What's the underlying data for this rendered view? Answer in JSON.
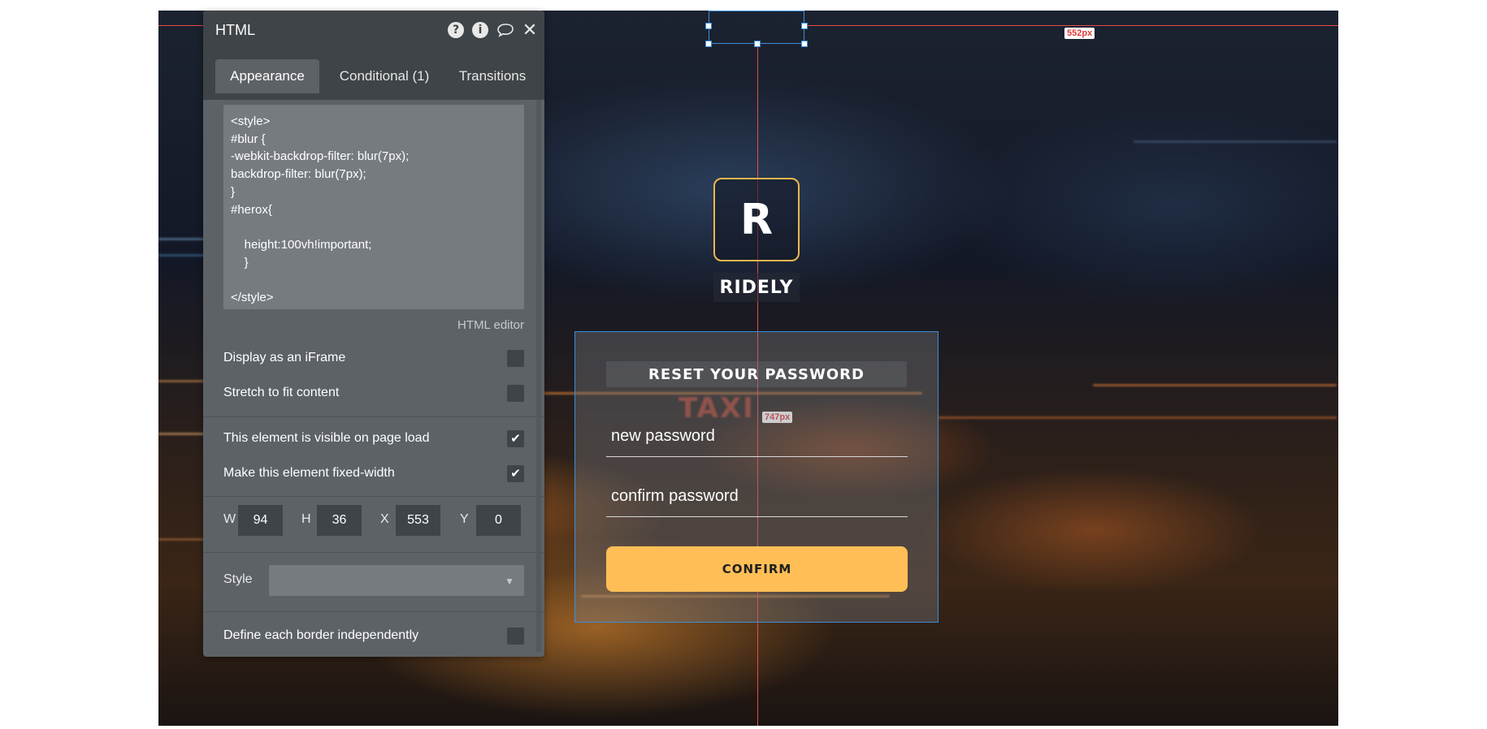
{
  "panel": {
    "title": "HTML",
    "icons": [
      "question-icon",
      "info-icon",
      "comment-icon",
      "close-icon"
    ],
    "tabs": [
      {
        "label": "Appearance",
        "active": true
      },
      {
        "label": "Conditional (1)",
        "active": false
      },
      {
        "label": "Transitions",
        "active": false
      }
    ],
    "code": "<style>\n#blur {\n-webkit-backdrop-filter: blur(7px);\nbackdrop-filter: blur(7px);\n}\n#herox{\n\n    height:100vh!important;\n    }\n\n</style>",
    "html_editor_label": "HTML editor",
    "options": {
      "display_iframe": {
        "label": "Display as an iFrame",
        "checked": false
      },
      "stretch": {
        "label": "Stretch to fit content",
        "checked": false
      },
      "visible_on_load": {
        "label": "This element is visible on page load",
        "checked": true
      },
      "fixed_width": {
        "label": "Make this element fixed-width",
        "checked": true
      },
      "border_independent": {
        "label": "Define each border independently",
        "checked": false
      }
    },
    "dimensions": {
      "w_label": "W",
      "w": "94",
      "h_label": "H",
      "h": "36",
      "x_label": "X",
      "x": "553",
      "y_label": "Y",
      "y": "0"
    },
    "style_label": "Style",
    "style_value": ""
  },
  "canvas": {
    "guide_label_top": "552px",
    "guide_label_mid": "747px",
    "logo_letter": "R",
    "brand_name": "RIDELY",
    "card_title": "RESET YOUR PASSWORD",
    "new_password_placeholder": "new password",
    "confirm_password_placeholder": "confirm password",
    "confirm_button": "CONFIRM",
    "background_words": "TAXI"
  },
  "colors": {
    "accent": "#ffbf56",
    "logo_border": "#f0b64c",
    "guide": "#e84a4a",
    "selection": "#3a8ed8",
    "panel_bg": "#5d6267",
    "panel_header": "#3f4448"
  }
}
